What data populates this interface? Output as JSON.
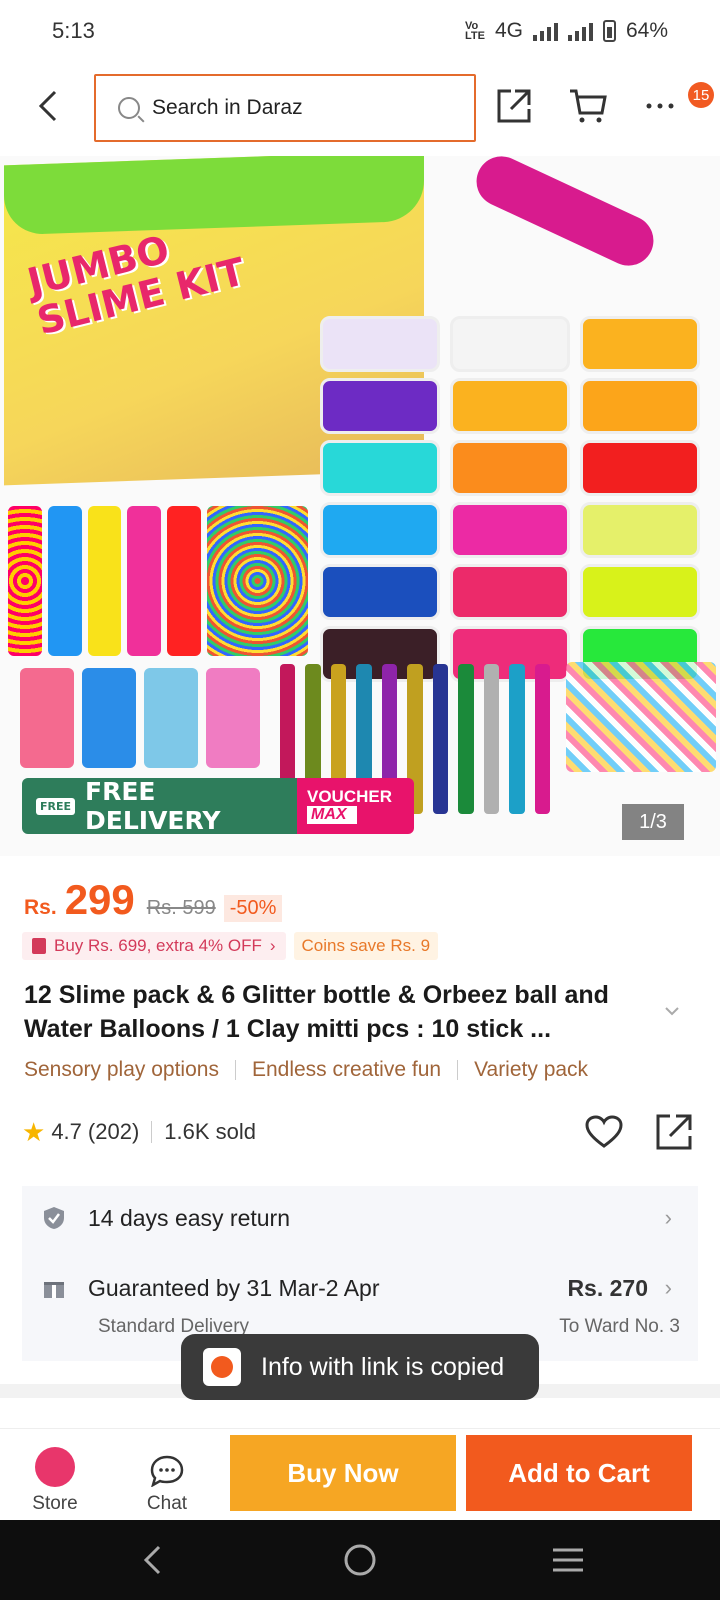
{
  "status_bar": {
    "time": "5:13",
    "network": "4G",
    "battery": "64%"
  },
  "header": {
    "search_placeholder": "Search in Daraz",
    "cart_badge": "15"
  },
  "hero": {
    "box_title": "JUMBO SLIME KIT",
    "free_delivery": "FREE DELIVERY",
    "voucher": "VOUCHER",
    "voucher_max": "MAX",
    "free_tag": "FREE",
    "image_counter": "1/3"
  },
  "price": {
    "currency": "Rs.",
    "current": "299",
    "original": "Rs. 599",
    "discount": "-50%"
  },
  "promos": {
    "buy_more": "Buy Rs. 699, extra 4% OFF",
    "coins": "Coins save Rs. 9"
  },
  "product": {
    "title": "12 Slime pack & 6 Glitter bottle & Orbeez ball and Water Balloons / 1 Clay mitti pcs : 10 stick ...",
    "tags": [
      "Sensory play options",
      "Endless creative fun",
      "Variety pack"
    ],
    "rating": "4.7",
    "reviews": "(202)",
    "sold": "1.6K sold"
  },
  "service": {
    "return_label": "14 days easy return",
    "guarantee_label": "Guaranteed by 31 Mar-2 Apr",
    "delivery_fee": "Rs. 270",
    "delivery_type": "Standard Delivery",
    "destination": "To Ward No. 3"
  },
  "toast": {
    "message": "Info with link is copied"
  },
  "bottom_bar": {
    "store": "Store",
    "chat": "Chat",
    "buy_now": "Buy Now",
    "add_to_cart": "Add to Cart"
  },
  "colors": {
    "accent": "#f25a1e",
    "buy_now": "#f6a623",
    "free_delivery": "#2e7d5b",
    "voucher": "#e8136b"
  }
}
